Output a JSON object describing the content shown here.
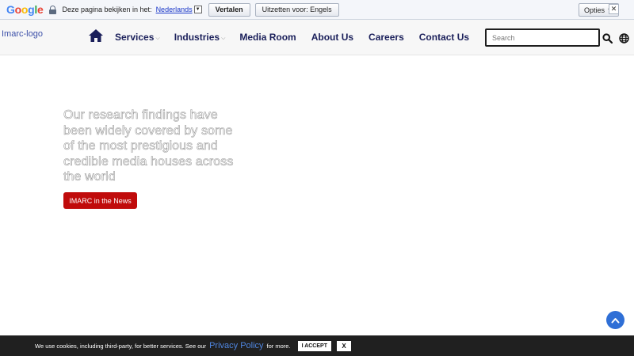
{
  "translate_bar": {
    "google_letters": [
      {
        "char": "G",
        "color": "#4285f4"
      },
      {
        "char": "o",
        "color": "#ea4335"
      },
      {
        "char": "o",
        "color": "#fbbc05"
      },
      {
        "char": "g",
        "color": "#4285f4"
      },
      {
        "char": "l",
        "color": "#34a853"
      },
      {
        "char": "e",
        "color": "#ea4335"
      }
    ],
    "prompt": "Deze pagina bekijken in het:",
    "language": "Nederlands",
    "translate_label": "Vertalen",
    "revert_label": "Uitzetten voor: Engels",
    "options_label": "Opties ▼",
    "close_label": "✕"
  },
  "header": {
    "logo_alt": "Imarc-logo",
    "nav": [
      {
        "label": "Services",
        "dropdown": true
      },
      {
        "label": "Industries",
        "dropdown": true
      },
      {
        "label": "Media Room",
        "dropdown": false
      },
      {
        "label": "About Us",
        "dropdown": false
      },
      {
        "label": "Careers",
        "dropdown": false
      },
      {
        "label": "Contact Us",
        "dropdown": false
      }
    ],
    "search_placeholder": "Search",
    "icons": [
      "home-icon",
      "search-icon",
      "globe-icon"
    ]
  },
  "hero": {
    "text": "Our research findings have been widely covered by some of the most prestigious and credible media houses across the world",
    "button_label": "IMARC in the News",
    "button_color": "#c00b0b"
  },
  "cookie": {
    "text": "We use cookies, including third-party, for better services. See our",
    "policy_link": "Privacy Policy",
    "more": "for more.",
    "accept_label": "I ACCEPT",
    "close_label": "X"
  },
  "colors": {
    "nav_text": "#1a1f5a",
    "accent_blue": "#2f6fd6",
    "cookie_bg": "#202020"
  }
}
